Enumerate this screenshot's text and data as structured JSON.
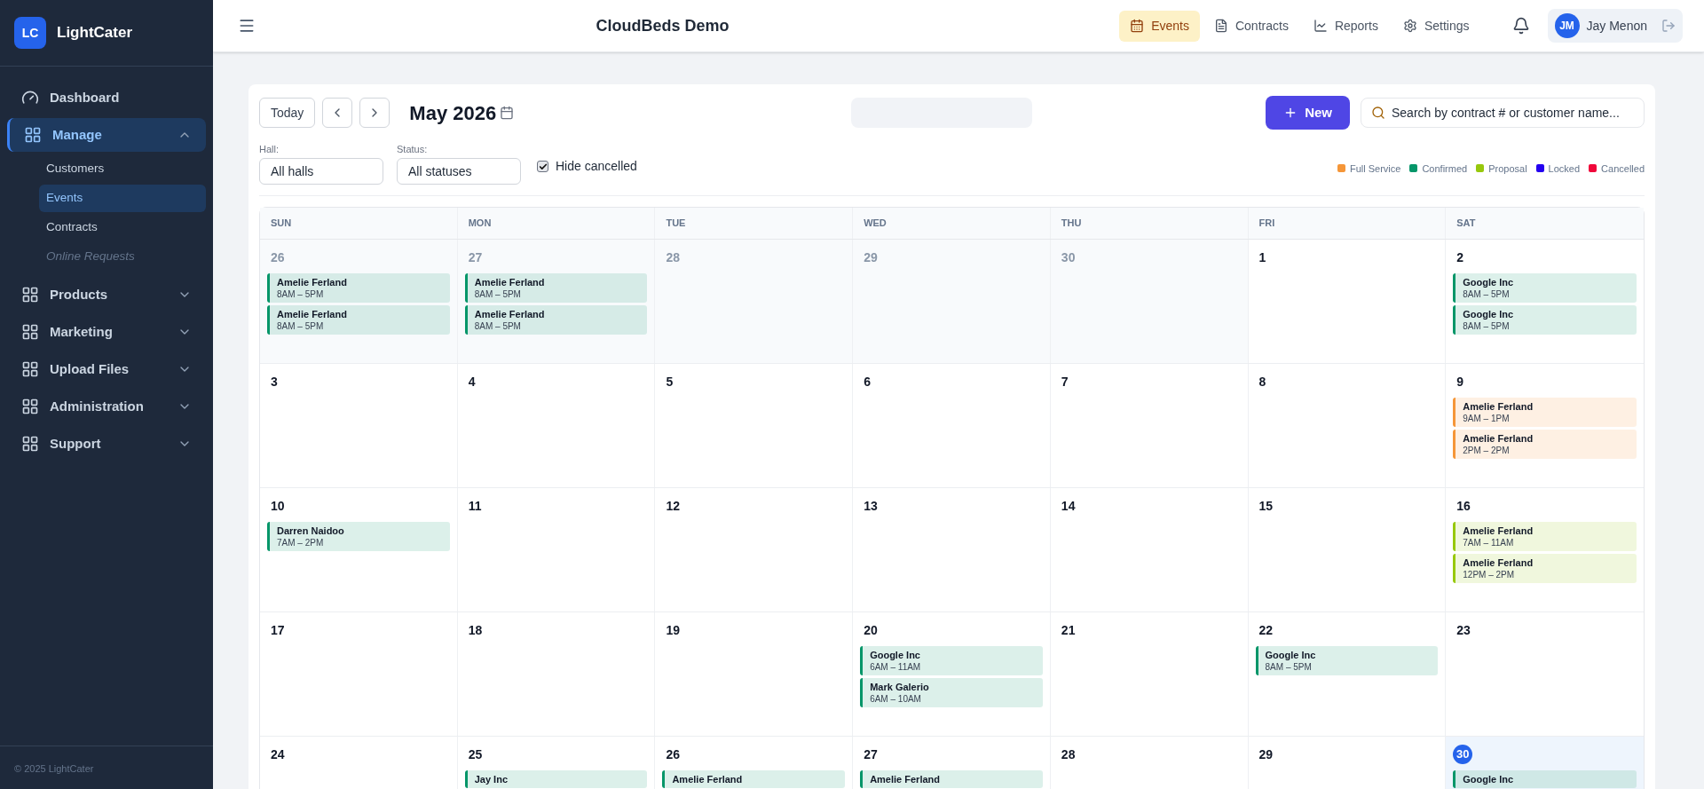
{
  "brand": {
    "logo": "LC",
    "name": "LightCater"
  },
  "sidebar": {
    "items": [
      {
        "label": "Dashboard",
        "kind": "link",
        "selected": false
      },
      {
        "label": "Manage",
        "kind": "group",
        "selected": true,
        "expanded": true,
        "children": [
          {
            "label": "Customers",
            "selected": false,
            "disabled": false
          },
          {
            "label": "Events",
            "selected": true,
            "disabled": false
          },
          {
            "label": "Contracts",
            "selected": false,
            "disabled": false
          },
          {
            "label": "Online Requests",
            "selected": false,
            "disabled": true
          }
        ]
      },
      {
        "label": "Products",
        "kind": "group",
        "selected": false,
        "expanded": false
      },
      {
        "label": "Marketing",
        "kind": "group",
        "selected": false,
        "expanded": false
      },
      {
        "label": "Upload Files",
        "kind": "group",
        "selected": false,
        "expanded": false
      },
      {
        "label": "Administration",
        "kind": "group",
        "selected": false,
        "expanded": false
      },
      {
        "label": "Support",
        "kind": "group",
        "selected": false,
        "expanded": false
      }
    ],
    "footer": "© 2025 LightCater"
  },
  "header": {
    "title": "CloudBeds Demo",
    "nav": [
      {
        "label": "Events",
        "selected": true
      },
      {
        "label": "Contracts",
        "selected": false
      },
      {
        "label": "Reports",
        "selected": false
      },
      {
        "label": "Settings",
        "selected": false
      }
    ],
    "user": {
      "initials": "JM",
      "name": "Jay Menon"
    }
  },
  "toolbar": {
    "today": "Today",
    "month": "May 2026",
    "new_button": "New",
    "search": {
      "placeholder": "Search by contract # or customer name..."
    }
  },
  "filters": {
    "hall": {
      "label": "Hall:",
      "value": "All halls"
    },
    "status": {
      "label": "Status:",
      "value": "All statuses"
    },
    "hide_cancelled": {
      "label": "Hide cancelled",
      "checked": true
    }
  },
  "legend": [
    {
      "label": "Full Service",
      "color": "#f59638"
    },
    {
      "label": "Confirmed",
      "color": "#059669"
    },
    {
      "label": "Proposal",
      "color": "#97c80c"
    },
    {
      "label": "Locked",
      "color": "#2400f0"
    },
    {
      "label": "Cancelled",
      "color": "#f0073a"
    }
  ],
  "calendar": {
    "weekdays": [
      "SUN",
      "MON",
      "TUE",
      "WED",
      "THU",
      "FRI",
      "SAT"
    ],
    "weeks": [
      [
        {
          "day": "26",
          "muted": true,
          "today": false,
          "events": [
            {
              "name": "Amelie Ferland",
              "time": "8AM – 5PM",
              "color": "#059669"
            },
            {
              "name": "Amelie Ferland",
              "time": "8AM – 5PM",
              "color": "#059669"
            }
          ]
        },
        {
          "day": "27",
          "muted": true,
          "today": false,
          "events": [
            {
              "name": "Amelie Ferland",
              "time": "8AM – 5PM",
              "color": "#059669"
            },
            {
              "name": "Amelie Ferland",
              "time": "8AM – 5PM",
              "color": "#059669"
            }
          ]
        },
        {
          "day": "28",
          "muted": true,
          "today": false
        },
        {
          "day": "29",
          "muted": true,
          "today": false
        },
        {
          "day": "30",
          "muted": true,
          "today": false
        },
        {
          "day": "1",
          "muted": false,
          "today": false
        },
        {
          "day": "2",
          "muted": false,
          "today": false,
          "events": [
            {
              "name": "Google Inc",
              "time": "8AM – 5PM",
              "color": "#059669"
            },
            {
              "name": "Google Inc",
              "time": "8AM – 5PM",
              "color": "#059669"
            }
          ]
        }
      ],
      [
        {
          "day": "3",
          "muted": false,
          "today": false
        },
        {
          "day": "4",
          "muted": false,
          "today": false
        },
        {
          "day": "5",
          "muted": false,
          "today": false
        },
        {
          "day": "6",
          "muted": false,
          "today": false
        },
        {
          "day": "7",
          "muted": false,
          "today": false
        },
        {
          "day": "8",
          "muted": false,
          "today": false
        },
        {
          "day": "9",
          "muted": false,
          "today": false,
          "events": [
            {
              "name": "Amelie Ferland",
              "time": "9AM – 1PM",
              "color": "#f59638"
            },
            {
              "name": "Amelie Ferland",
              "time": "2PM – 2PM",
              "color": "#f59638"
            }
          ]
        }
      ],
      [
        {
          "day": "10",
          "muted": false,
          "today": false,
          "events": [
            {
              "name": "Darren Naidoo",
              "time": "7AM – 2PM",
              "color": "#059669"
            }
          ]
        },
        {
          "day": "11",
          "muted": false,
          "today": false
        },
        {
          "day": "12",
          "muted": false,
          "today": false
        },
        {
          "day": "13",
          "muted": false,
          "today": false
        },
        {
          "day": "14",
          "muted": false,
          "today": false
        },
        {
          "day": "15",
          "muted": false,
          "today": false
        },
        {
          "day": "16",
          "muted": false,
          "today": false,
          "events": [
            {
              "name": "Amelie Ferland",
              "time": "7AM – 11AM",
              "color": "#97c80c"
            },
            {
              "name": "Amelie Ferland",
              "time": "12PM – 2PM",
              "color": "#97c80c"
            }
          ]
        }
      ],
      [
        {
          "day": "17",
          "muted": false,
          "today": false
        },
        {
          "day": "18",
          "muted": false,
          "today": false
        },
        {
          "day": "19",
          "muted": false,
          "today": false
        },
        {
          "day": "20",
          "muted": false,
          "today": false,
          "events": [
            {
              "name": "Google Inc",
              "time": "6AM – 11AM",
              "color": "#059669"
            },
            {
              "name": "Mark Galerio",
              "time": "6AM – 10AM",
              "color": "#059669"
            }
          ]
        },
        {
          "day": "21",
          "muted": false,
          "today": false
        },
        {
          "day": "22",
          "muted": false,
          "today": false,
          "events": [
            {
              "name": "Google Inc",
              "time": "8AM – 5PM",
              "color": "#059669"
            }
          ]
        },
        {
          "day": "23",
          "muted": false,
          "today": false
        }
      ],
      [
        {
          "day": "24",
          "muted": false,
          "today": false
        },
        {
          "day": "25",
          "muted": false,
          "today": false,
          "events": [
            {
              "name": "Jay Inc",
              "color": "#059669"
            }
          ]
        },
        {
          "day": "26",
          "muted": false,
          "today": false,
          "events": [
            {
              "name": "Amelie Ferland",
              "color": "#059669"
            }
          ]
        },
        {
          "day": "27",
          "muted": false,
          "today": false,
          "events": [
            {
              "name": "Amelie Ferland",
              "color": "#059669"
            }
          ]
        },
        {
          "day": "28",
          "muted": false,
          "today": false
        },
        {
          "day": "29",
          "muted": false,
          "today": false
        },
        {
          "day": "30",
          "muted": false,
          "today": true,
          "events": [
            {
              "name": "Google Inc",
              "color": "#059669"
            }
          ]
        }
      ]
    ]
  }
}
